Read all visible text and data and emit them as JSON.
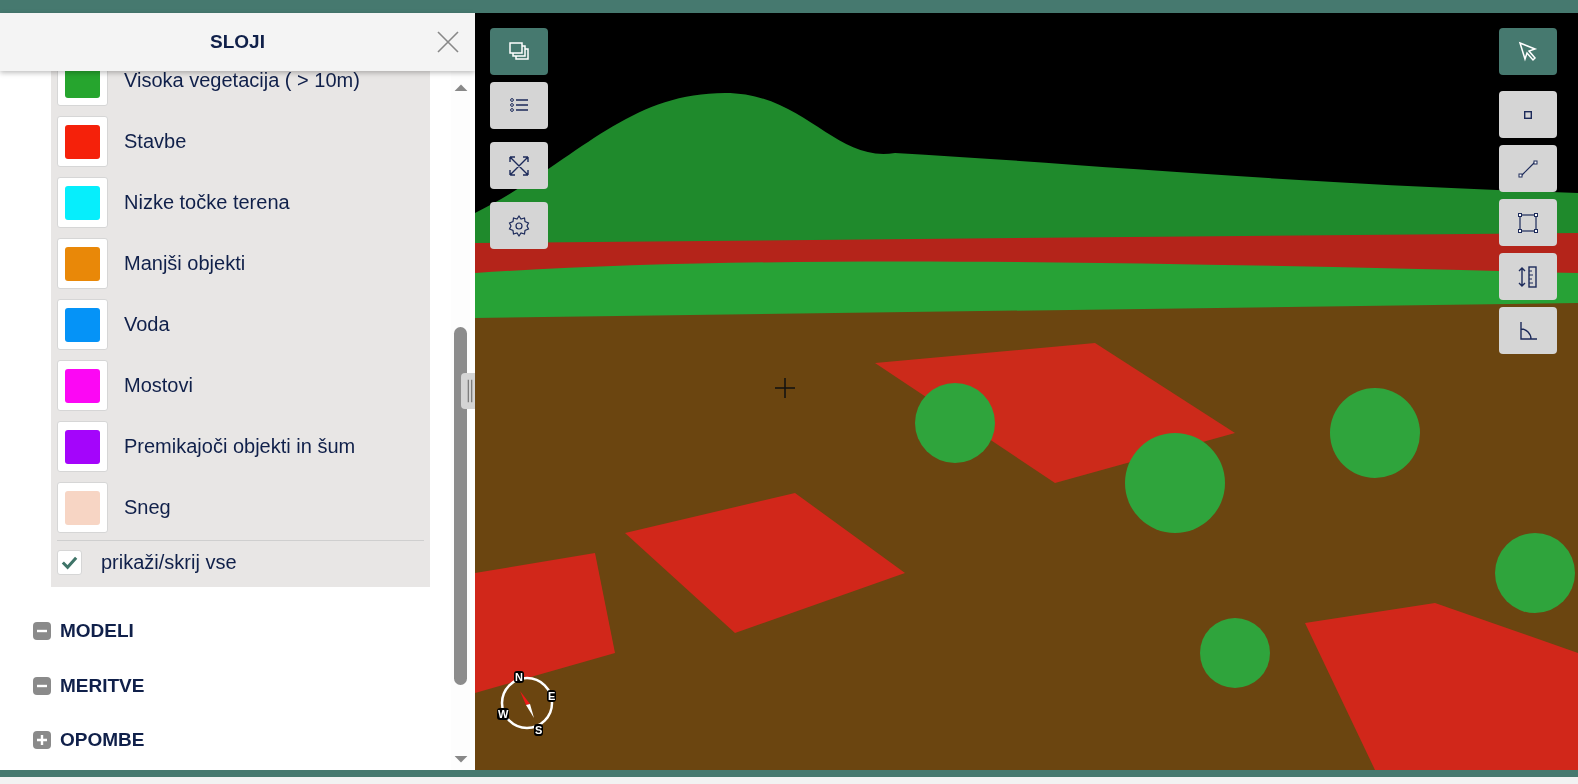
{
  "panel": {
    "title": "SLOJI",
    "legend": [
      {
        "label": "Visoka vegetacija ( > 10m)",
        "color": "#26a52e"
      },
      {
        "label": "Stavbe",
        "color": "#f5210a"
      },
      {
        "label": "Nizke točke terena",
        "color": "#06eefc"
      },
      {
        "label": "Manjši objekti",
        "color": "#e98808"
      },
      {
        "label": "Voda",
        "color": "#0593f7"
      },
      {
        "label": "Mostovi",
        "color": "#fc07f4"
      },
      {
        "label": "Premikajoči objekti in šum",
        "color": "#a405fb"
      },
      {
        "label": "Sneg",
        "color": "#f7d5c4"
      }
    ],
    "toggle_all": {
      "label": "prikaži/skrij vse",
      "checked": true
    },
    "sections": [
      {
        "label": "MODELI",
        "expanded": true
      },
      {
        "label": "MERITVE",
        "expanded": true
      },
      {
        "label": "OPOMBE",
        "expanded": false
      }
    ]
  },
  "viewer": {
    "left_tools": [
      {
        "kind": "layers",
        "selected": true
      },
      {
        "kind": "list",
        "selected": false
      },
      {
        "kind": "fullscreen",
        "selected": false
      },
      {
        "kind": "settings",
        "selected": false
      }
    ],
    "right_tools": [
      {
        "kind": "pointer",
        "selected": true
      },
      {
        "kind": "point",
        "selected": false
      },
      {
        "kind": "line",
        "selected": false
      },
      {
        "kind": "area",
        "selected": false
      },
      {
        "kind": "height",
        "selected": false
      },
      {
        "kind": "angle",
        "selected": false
      }
    ],
    "compass": {
      "north": "N",
      "east": "E",
      "south": "S",
      "west": "W"
    }
  }
}
